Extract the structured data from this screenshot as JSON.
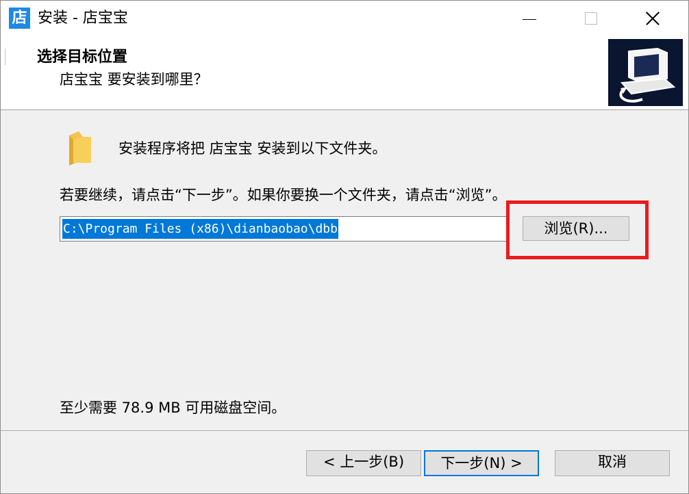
{
  "window": {
    "title": "安装 - 店宝宝",
    "app_icon_glyph": "店"
  },
  "header": {
    "title": "选择目标位置",
    "subtitle": "店宝宝 要安装到哪里？"
  },
  "body": {
    "line1": "安装程序将把 店宝宝 安装到以下文件夹。",
    "line2": "若要继续，请点击“下一步”。如果你要换一个文件夹，请点击“浏览”。",
    "path_value": "C:\\Program Files (x86)\\dianbaobao\\dbb",
    "browse_label": "浏览(R)...",
    "disk_space": "至少需要 78.9 MB 可用磁盘空间。"
  },
  "footer": {
    "back_label": "< 上一步(B)",
    "next_label": "下一步(N) >",
    "cancel_label": "取消"
  },
  "colors": {
    "selection": "#0078d7",
    "highlight_box": "#ea1b1b",
    "header_image_bg": "#0a1530",
    "app_icon": "#1e88e5",
    "folder": "#f2c34e"
  },
  "icons": {
    "app": "store-app-icon",
    "folder": "folder-icon",
    "header": "install-computer-icon"
  }
}
